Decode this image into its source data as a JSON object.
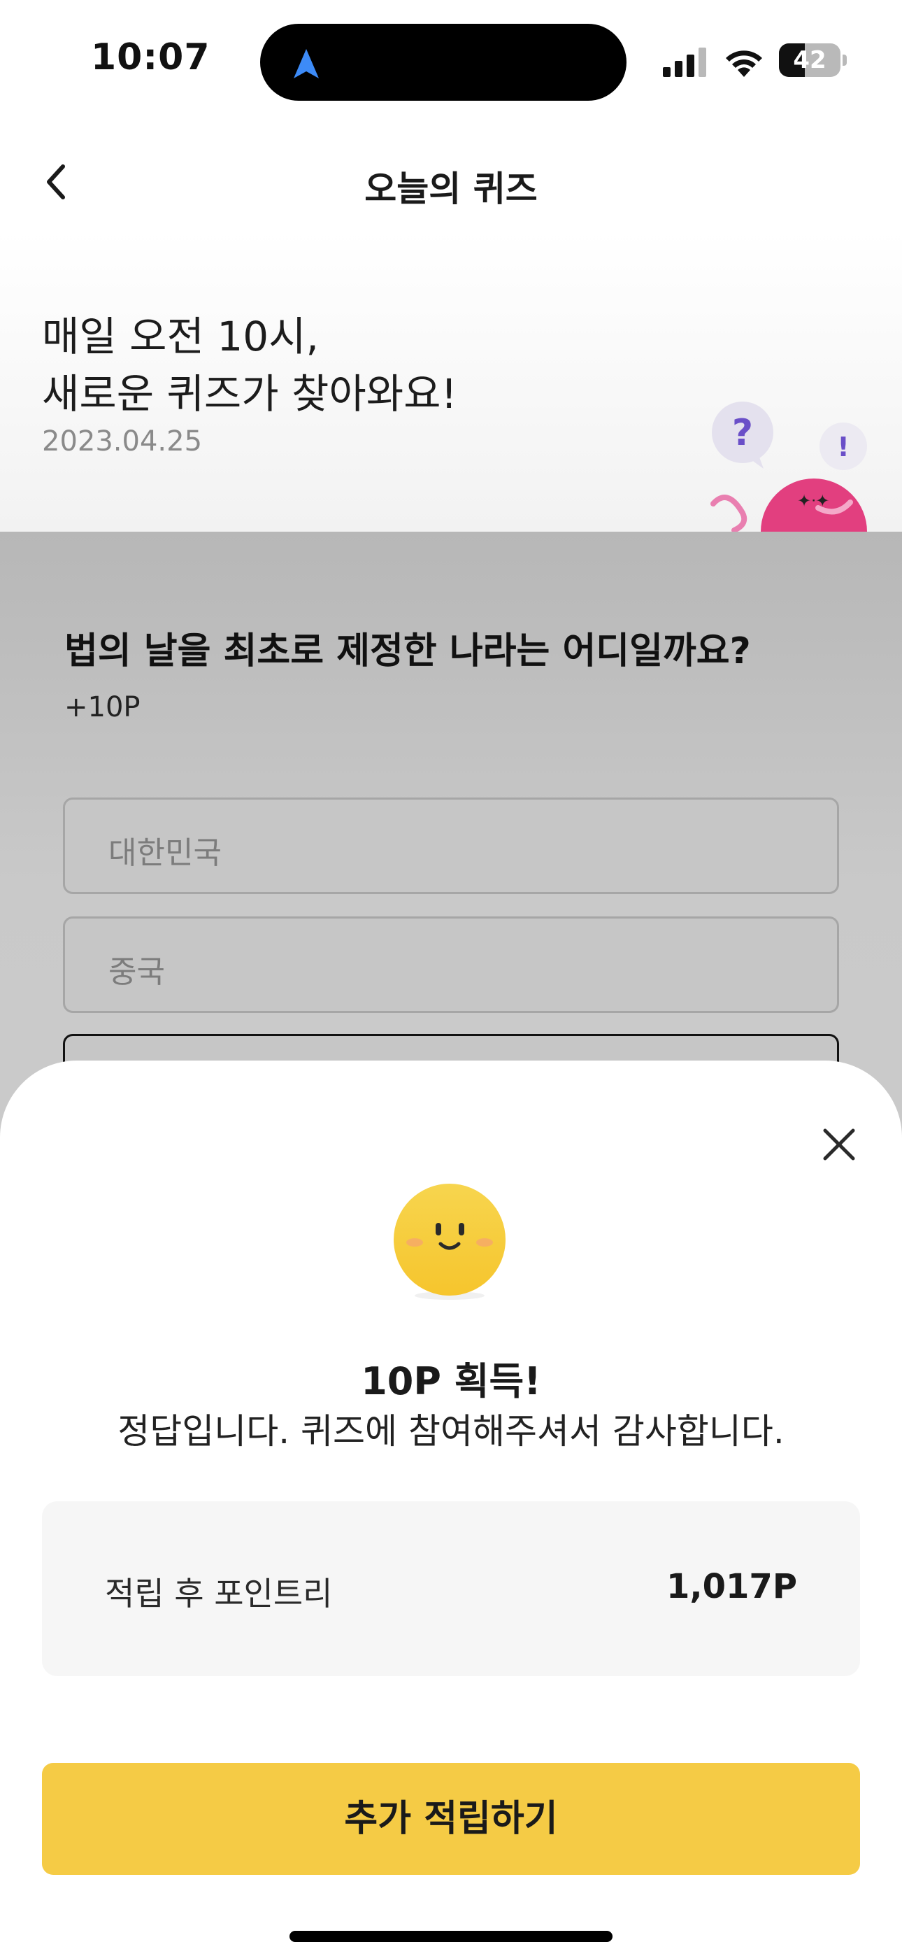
{
  "status_bar": {
    "time": "10:07",
    "battery_level": "42",
    "battery_fraction": 0.42,
    "icons": [
      "navigation-arrow-icon",
      "signal-icon",
      "wifi-icon",
      "battery-icon"
    ]
  },
  "header": {
    "title": "오늘의 퀴즈",
    "back_icon": "chevron-left-icon"
  },
  "hero": {
    "headline_line1": "매일 오전 10시,",
    "headline_line2": "새로운 퀴즈가 찾아와요!",
    "date": "2023.04.25",
    "character_bubbles": [
      "?",
      "!"
    ]
  },
  "quiz": {
    "question": "법의 날을 최초로 제정한 나라는 어디일까요?",
    "points": "+10P",
    "options": [
      {
        "label": "대한민국"
      },
      {
        "label": "중국"
      }
    ]
  },
  "result_sheet": {
    "close_icon": "close-icon",
    "emoji": "smiley-face-icon",
    "title": "10P 획득!",
    "message": "정답입니다. 퀴즈에 참여해주셔서 감사합니다.",
    "points_label": "적립 후 포인트리",
    "points_value": "1,017P",
    "cta_label": "추가 적립하기"
  },
  "colors": {
    "accent_yellow": "#f5cb45",
    "character_pink": "#e23f7f",
    "bubble_purple": "#6a4fc8",
    "nav_arrow_blue": "#3d8bf7"
  }
}
